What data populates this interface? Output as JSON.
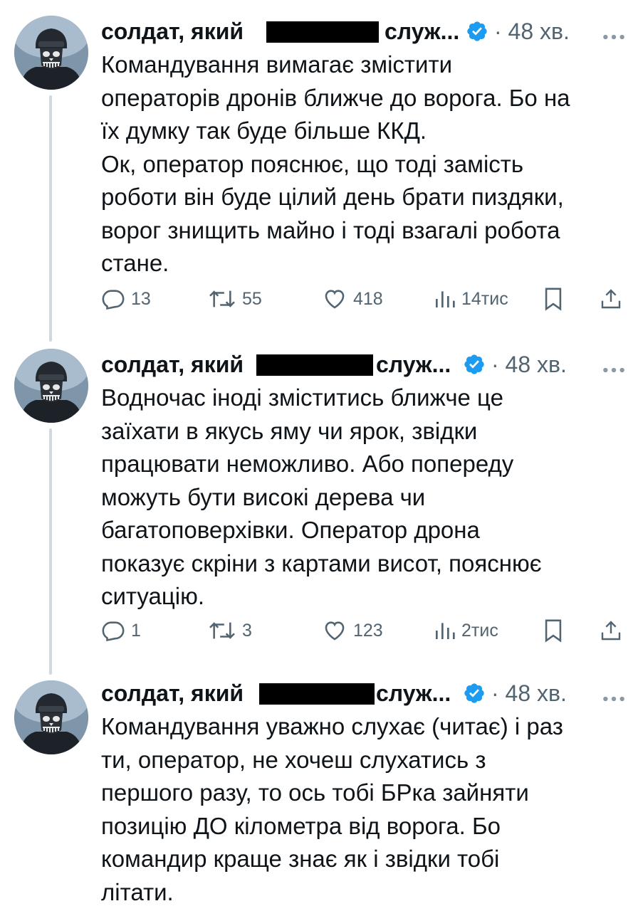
{
  "tweets": [
    {
      "author_name_start": "солдат, який",
      "author_name_end": "служ...",
      "time": "· 48 хв.",
      "body_lines": [
        "Командування вимагає змістити",
        "операторів дронів ближче до ворога. Бо на",
        "їх думку так буде більше ККД.",
        "Ок, оператор пояснює, що тоді замість",
        "роботи він буде цілий день брати пиздяки,",
        "ворог знищить майно і тоді взагалі робота",
        "стане."
      ],
      "replies": "13",
      "reposts": "55",
      "likes": "418",
      "views": "14тис"
    },
    {
      "author_name_start": "солдат, який",
      "author_name_end": "служ...",
      "time": "· 48 хв.",
      "body_lines": [
        "Водночас іноді зміститись ближче це",
        "заїхати в якусь яму чи ярок, звідки",
        "працювати неможливо. Або попереду",
        "можуть бути високі дерева чи",
        "багатоповерхівки. Оператор дрона",
        "показує скріни з картами висот, пояснює",
        "ситуацію."
      ],
      "replies": "1",
      "reposts": "3",
      "likes": "123",
      "views": "2тис"
    },
    {
      "author_name_start": "солдат, який",
      "author_name_end": "служ...",
      "time": "· 48 хв.",
      "body_lines": [
        "Командування уважно слухає (читає) і раз",
        "ти, оператор, не хочеш слухатись з",
        "першого разу, то ось тобі БРка зайняти",
        "позицію ДО кілометра від ворога. Бо",
        "командир краще знає як і звідки тобі",
        "літати."
      ]
    }
  ],
  "icons": {
    "avatar": "soldier-skull-mask-avatar",
    "verified": "verified-badge-icon",
    "more": "more-dots-icon",
    "reply": "reply-icon",
    "repost": "repost-icon",
    "like": "heart-icon",
    "views": "views-bar-chart-icon",
    "bookmark": "bookmark-icon",
    "share": "share-icon"
  },
  "colors": {
    "text": "#0f1419",
    "secondary": "#536471",
    "verified": "#1d9bf0",
    "thread_line": "#cfd9de",
    "redaction": "#000000"
  }
}
